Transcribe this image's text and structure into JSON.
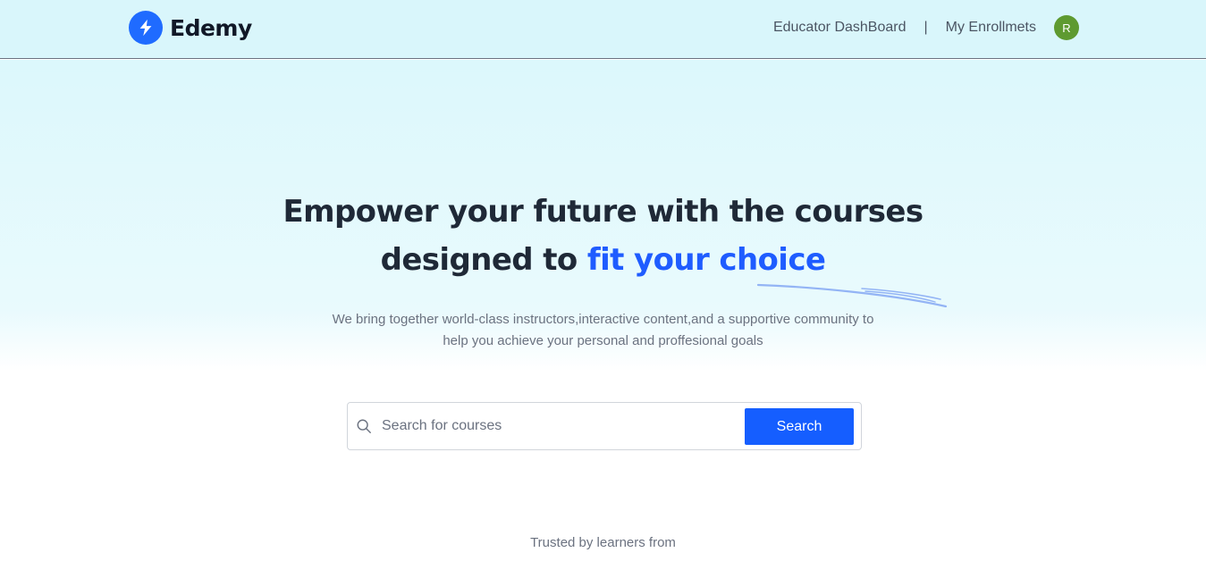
{
  "brand": {
    "name": "Edemy",
    "icon": "lightning-bolt-icon"
  },
  "nav": {
    "educator_label": "Educator DashBoard",
    "separator": "|",
    "enrollments_label": "My Enrollmets",
    "avatar_initial": "R"
  },
  "hero": {
    "headline_line1": "Empower your future with the courses",
    "headline_line2_prefix": "designed to",
    "headline_line2_accent": "fit your choice",
    "subtext_line1": "We bring together world-class instructors,interactive content,and a supportive community to",
    "subtext_line2": "help you achieve your personal and proffesional goals"
  },
  "search": {
    "placeholder": "Search for courses",
    "value": "",
    "button_label": "Search",
    "icon": "search-icon"
  },
  "trusted_label": "Trusted by learners from",
  "colors": {
    "accent": "#1f5cff",
    "button": "#155eff",
    "header_bg": "#d9f6fb",
    "avatar_bg": "#5e9a30"
  }
}
